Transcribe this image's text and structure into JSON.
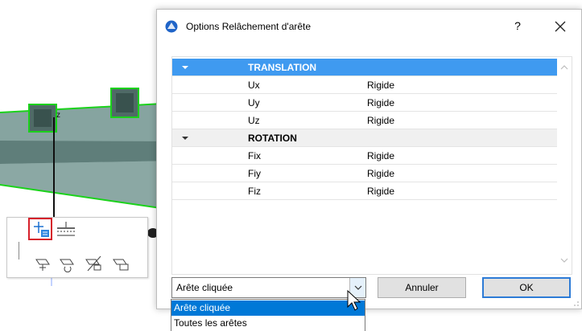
{
  "dialog": {
    "title": "Options Relâchement d'arête",
    "help_label": "?",
    "groups": [
      {
        "label": "TRANSLATION",
        "selected": true,
        "params": [
          {
            "name": "Ux",
            "value": "Rigide"
          },
          {
            "name": "Uy",
            "value": "Rigide"
          },
          {
            "name": "Uz",
            "value": "Rigide"
          }
        ]
      },
      {
        "label": "ROTATION",
        "selected": false,
        "params": [
          {
            "name": "Fix",
            "value": "Rigide"
          },
          {
            "name": "Fiy",
            "value": "Rigide"
          },
          {
            "name": "Fiz",
            "value": "Rigide"
          }
        ]
      }
    ],
    "select_value": "Arête cliquée",
    "cancel_label": "Annuler",
    "ok_label": "OK",
    "dropdown_options": [
      "Arête cliquée",
      "Toutes les arêtes"
    ]
  },
  "viewport": {
    "axis_label": "z"
  },
  "colors": {
    "selection_blue": "#3f9af0",
    "list_highlight": "#0078d7",
    "ok_border": "#2d7bd6",
    "toolbar_selected_border": "#d6212b",
    "slab_green": "#1bd21b"
  }
}
